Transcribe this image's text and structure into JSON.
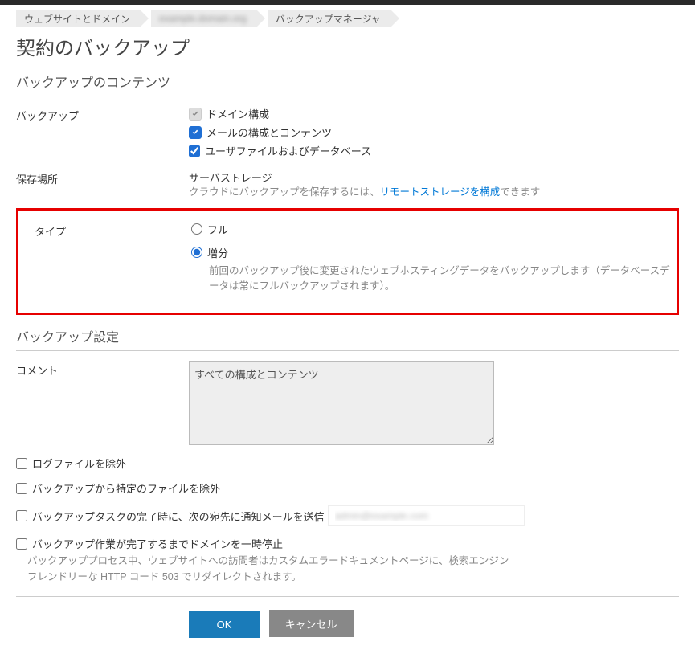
{
  "breadcrumb": {
    "items": [
      "ウェブサイトとドメイン",
      "example.domain.org",
      "バックアップマネージャ"
    ]
  },
  "page_title": "契約のバックアップ",
  "sections": {
    "content_heading": "バックアップのコンテンツ",
    "settings_heading": "バックアップ設定"
  },
  "backup_content": {
    "label": "バックアップ",
    "domain_config": "ドメイン構成",
    "mail_config": "メールの構成とコンテンツ",
    "user_files": "ユーザファイルおよびデータベース"
  },
  "storage": {
    "label": "保存場所",
    "value": "サーバストレージ",
    "helper_prefix": "クラウドにバックアップを保存するには、",
    "helper_link": "リモートストレージを構成",
    "helper_suffix": "できます"
  },
  "type": {
    "label": "タイプ",
    "full": "フル",
    "incremental": "増分",
    "incremental_desc": "前回のバックアップ後に変更されたウェブホスティングデータをバックアップします（データベースデータは常にフルバックアップされます）。"
  },
  "comment": {
    "label": "コメント",
    "value": "すべての構成とコンテンツ"
  },
  "options": {
    "exclude_logs": "ログファイルを除外",
    "exclude_specific": "バックアップから特定のファイルを除外",
    "notify_email_label": "バックアップタスクの完了時に、次の宛先に通知メールを送信",
    "notify_email_value": "admin@example.com",
    "suspend_domain": "バックアップ作業が完了するまでドメインを一時停止",
    "suspend_desc": "バックアッププロセス中、ウェブサイトへの訪問者はカスタムエラードキュメントページに、検索エンジンフレンドリーな HTTP コード 503 でリダイレクトされます。"
  },
  "buttons": {
    "ok": "OK",
    "cancel": "キャンセル"
  }
}
